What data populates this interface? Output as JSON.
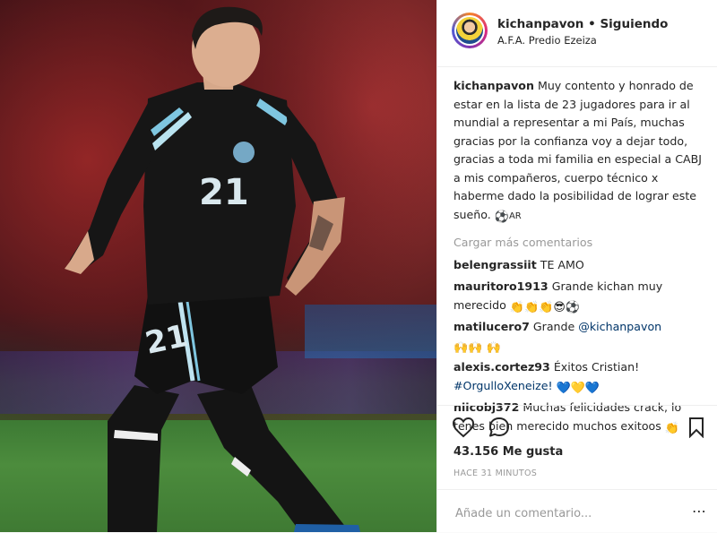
{
  "header": {
    "username": "kichanpavon",
    "separator": "•",
    "follow_status": "Siguiendo",
    "location": "A.F.A. Predio Ezeiza"
  },
  "caption": {
    "username": "kichanpavon",
    "text": "Muy contento y honrado de estar en la lista de 23 jugadores para ir al mundial a representar a mi País, muchas gracias por la confianza voy a dejar todo, gracias a toda mi familia en especial a CABJ a mis compañeros, cuerpo técnico x haberme dado la posibilidad de lograr este sueño.",
    "emoji": "⚽",
    "flag": "AR"
  },
  "load_more": "Cargar más comentarios",
  "comments": [
    {
      "username": "belengrassiit",
      "text": "TE AMO"
    },
    {
      "username": "mauritoro1913",
      "text": "Grande kichan muy merecido",
      "emoji": "👏👏👏😎⚽"
    },
    {
      "username": "matilucero7",
      "text": "Grande",
      "mention": "@kichanpavon",
      "emoji": "🙌🙌 🙌"
    },
    {
      "username": "alexis.cortez93",
      "text": "Éxitos Cristian!",
      "hashtag": "#OrgulloXeneize!",
      "emoji": "💙💛💙"
    },
    {
      "username": "niicobj372",
      "text": "Muchas felicidades crack, lo tenes bien merecido muchos exitoos",
      "emoji": "👏"
    }
  ],
  "stats": {
    "likes": "43.156 Me gusta",
    "time": "HACE 31 MINUTOS"
  },
  "add_comment": {
    "placeholder": "Añade un comentario...",
    "more": "⋯"
  },
  "colors": {
    "link": "#003569",
    "muted": "#999999",
    "text": "#262626",
    "heart_blue": "#3897f0",
    "heart_yellow": "#f5b700"
  },
  "photo": {
    "jersey_number": "21"
  }
}
